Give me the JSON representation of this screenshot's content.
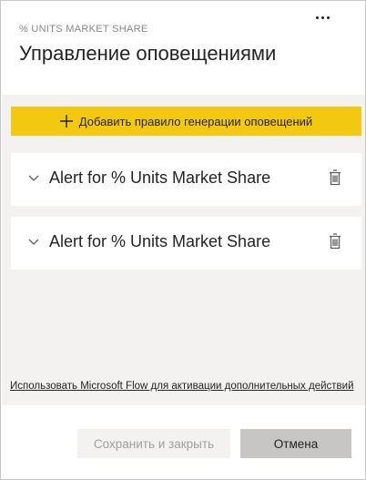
{
  "header": {
    "subtitle": "% UNITS MARKET SHARE",
    "title": "Управление оповещениями",
    "more_icon": "more-horizontal-icon"
  },
  "add_rule": {
    "label": "Добавить правило генерации оповещений",
    "icon": "plus-icon"
  },
  "alerts": [
    {
      "title": "Alert for % Units Market Share"
    },
    {
      "title": "Alert for % Units Market Share"
    }
  ],
  "flow_link": "Использовать Microsoft Flow для активации дополнительных действий",
  "footer": {
    "save_label": "Сохранить и закрыть",
    "cancel_label": "Отмена"
  },
  "colors": {
    "accent": "#f2c811",
    "body_background": "#f3f2f1"
  }
}
